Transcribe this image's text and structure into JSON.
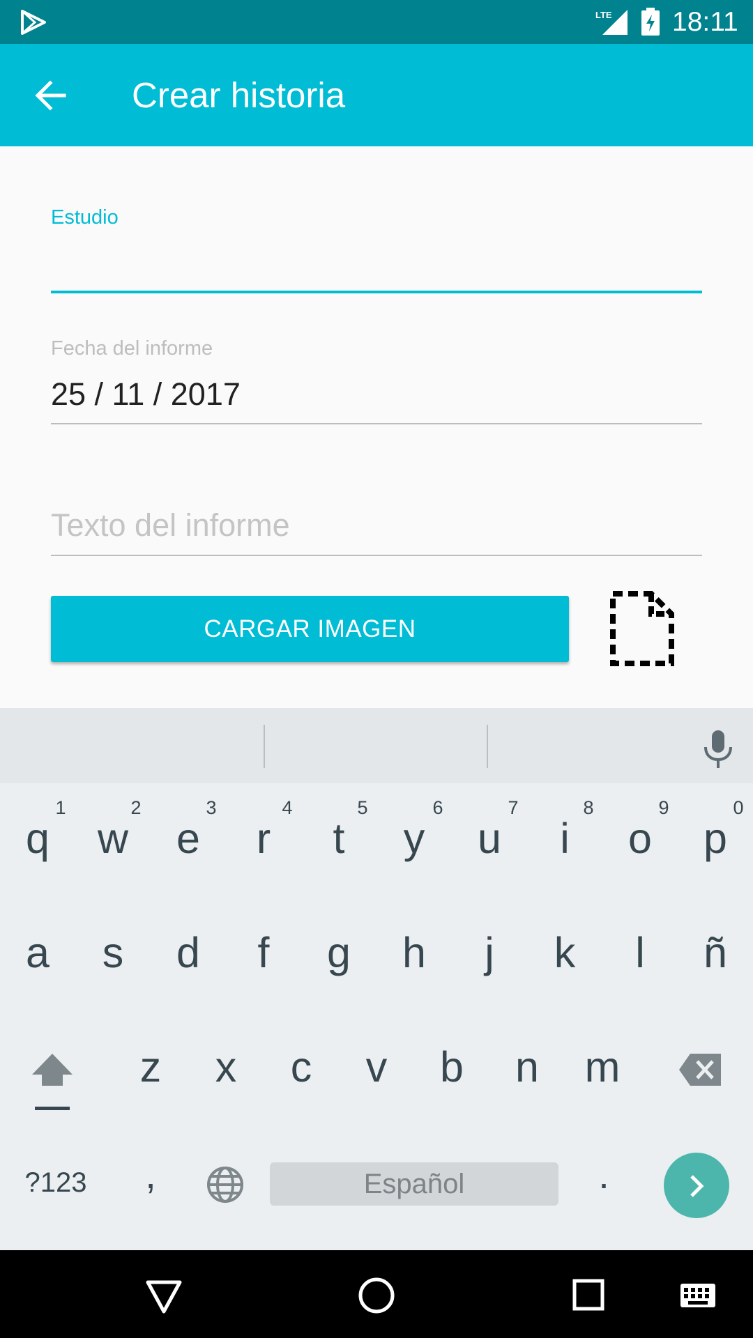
{
  "status_bar": {
    "time": "18:11",
    "network": "LTE"
  },
  "app_bar": {
    "title": "Crear historia"
  },
  "form": {
    "estudio_label": "Estudio",
    "estudio_value": "",
    "fecha_label": "Fecha del informe",
    "fecha_value": "25 / 11 / 2017",
    "texto_placeholder": "Texto del informe",
    "cargar_button": "CARGAR IMAGEN"
  },
  "keyboard": {
    "number_hints": [
      "1",
      "2",
      "3",
      "4",
      "5",
      "6",
      "7",
      "8",
      "9",
      "0"
    ],
    "row1": [
      "q",
      "w",
      "e",
      "r",
      "t",
      "y",
      "u",
      "i",
      "o",
      "p"
    ],
    "row2": [
      "a",
      "s",
      "d",
      "f",
      "g",
      "h",
      "j",
      "k",
      "l",
      "ñ"
    ],
    "row3": [
      "z",
      "x",
      "c",
      "v",
      "b",
      "n",
      "m"
    ],
    "symbols_key": "?123",
    "comma_key": ",",
    "space_label": "Español",
    "period_key": "."
  },
  "colors": {
    "accent": "#00bcd4",
    "status_bar": "#00838f",
    "enter_key": "#4db6ac"
  }
}
